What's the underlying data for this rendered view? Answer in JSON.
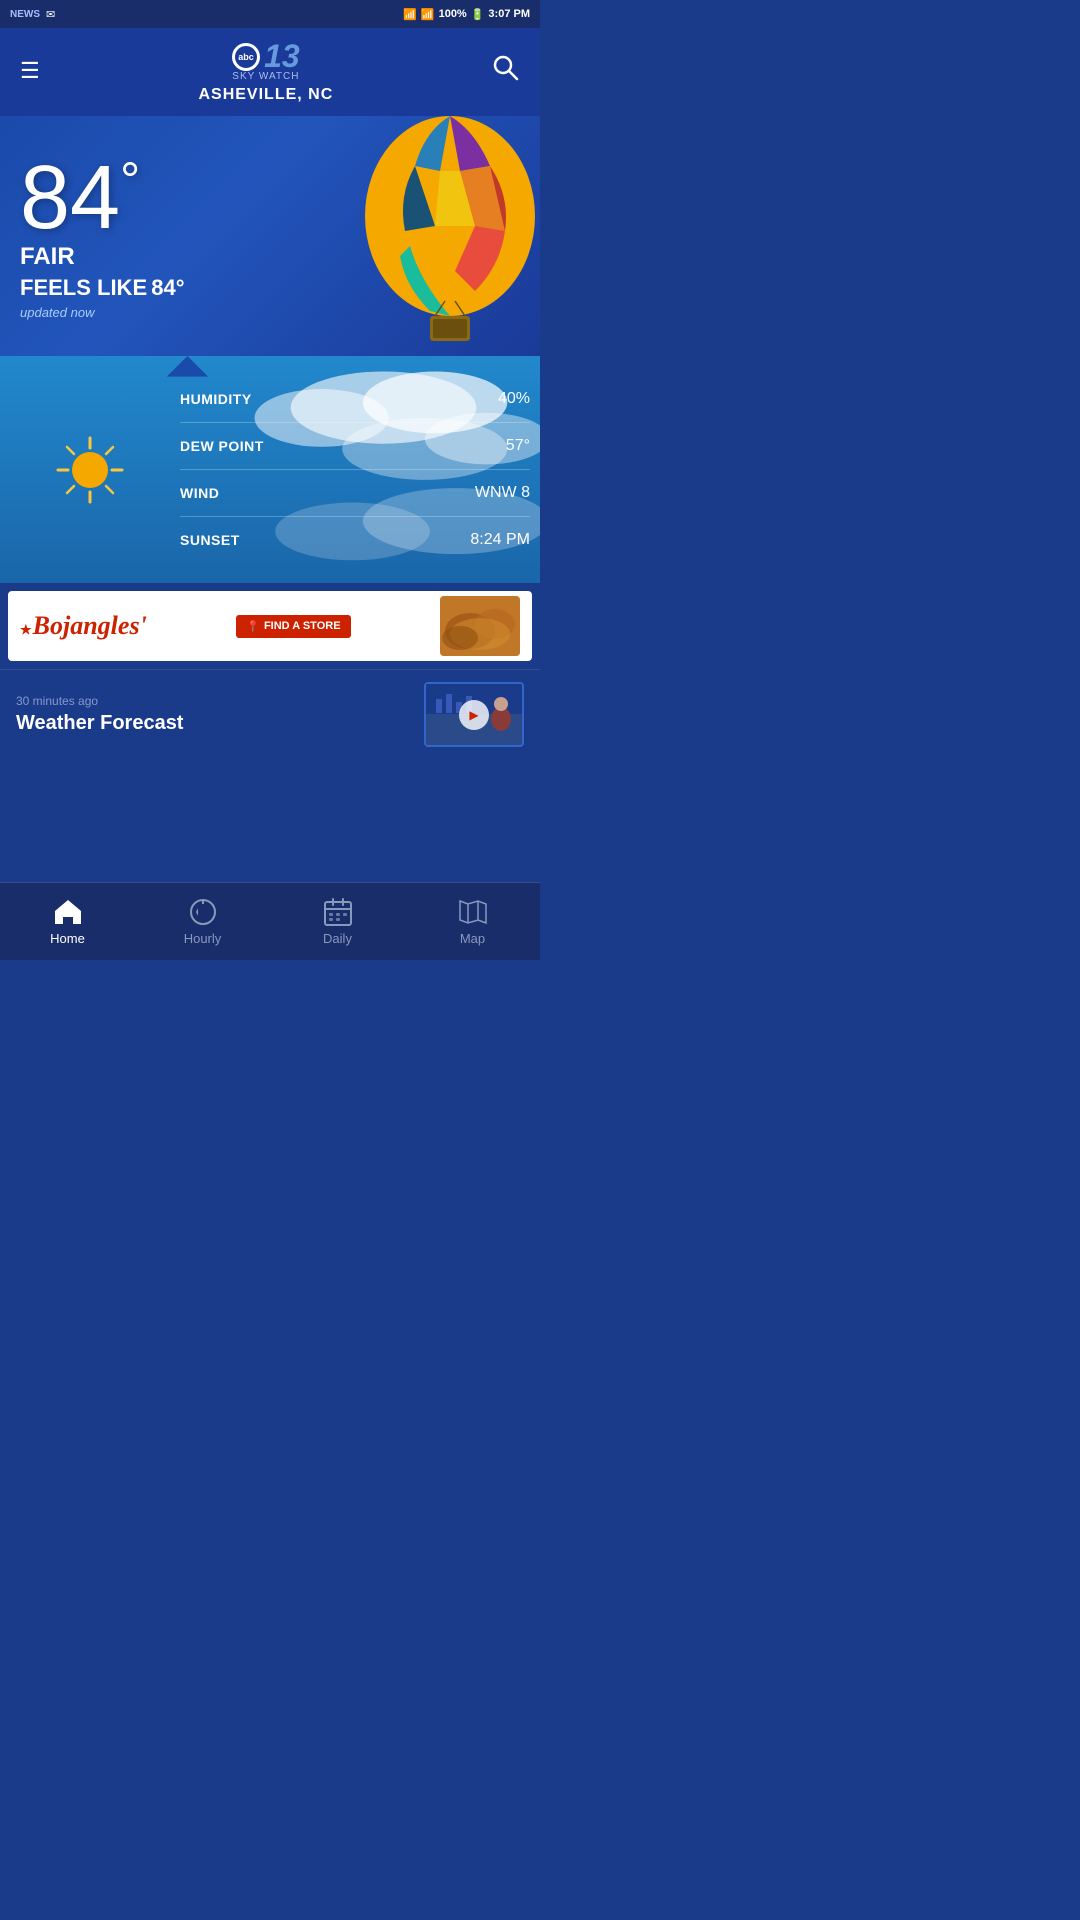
{
  "statusBar": {
    "time": "3:07 PM",
    "battery": "100%",
    "wifi": "wifi",
    "signal": "signal"
  },
  "header": {
    "menuLabel": "☰",
    "appName": "13",
    "appNetwork": "abc",
    "skywatch": "SKY WATCH",
    "city": "ASHEVILLE, NC",
    "searchIcon": "🔍"
  },
  "weather": {
    "temperature": "84",
    "degreeSymbol": "°",
    "condition": "FAIR",
    "feelsLikeLabel": "FEELS LIKE",
    "feelsLikeTemp": "84°",
    "updatedText": "updated now"
  },
  "details": {
    "humidity": {
      "label": "HUMIDITY",
      "value": "40%"
    },
    "dewPoint": {
      "label": "DEW POINT",
      "value": "57°"
    },
    "wind": {
      "label": "WIND",
      "value": "WNW 8"
    },
    "sunset": {
      "label": "SUNSET",
      "value": "8:24 PM"
    }
  },
  "ad": {
    "brand": "Bojangles'",
    "star": "★",
    "cta": "📍 FIND A STORE"
  },
  "newsPreview": {
    "timeAgo": "30 minutes ago",
    "title": "Weather Forecast"
  },
  "bottomNav": {
    "items": [
      {
        "id": "home",
        "label": "Home",
        "icon": "🏠",
        "active": true
      },
      {
        "id": "hourly",
        "label": "Hourly",
        "icon": "⏪",
        "active": false
      },
      {
        "id": "daily",
        "label": "Daily",
        "icon": "📅",
        "active": false
      },
      {
        "id": "map",
        "label": "Map",
        "icon": "🗺",
        "active": false
      }
    ]
  }
}
